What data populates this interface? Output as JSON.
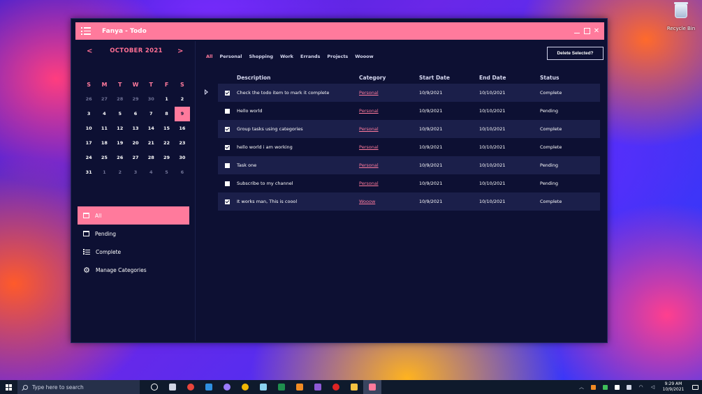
{
  "desktop": {
    "recycle_bin_label": "Recycle Bin"
  },
  "window": {
    "title": "Fanya - Todo",
    "close_glyph": "✕"
  },
  "calendar": {
    "prev": "<",
    "next": ">",
    "month_label": "OCTOBER 2021",
    "weekdays": [
      "S",
      "M",
      "T",
      "W",
      "T",
      "F",
      "S"
    ],
    "days": [
      {
        "n": "26",
        "other": true
      },
      {
        "n": "27",
        "other": true
      },
      {
        "n": "28",
        "other": true
      },
      {
        "n": "29",
        "other": true
      },
      {
        "n": "30",
        "other": true
      },
      {
        "n": "1"
      },
      {
        "n": "2"
      },
      {
        "n": "3"
      },
      {
        "n": "4"
      },
      {
        "n": "5"
      },
      {
        "n": "6"
      },
      {
        "n": "7"
      },
      {
        "n": "8"
      },
      {
        "n": "9",
        "today": true
      },
      {
        "n": "10"
      },
      {
        "n": "11"
      },
      {
        "n": "12"
      },
      {
        "n": "13"
      },
      {
        "n": "14"
      },
      {
        "n": "15"
      },
      {
        "n": "16"
      },
      {
        "n": "17"
      },
      {
        "n": "18"
      },
      {
        "n": "19"
      },
      {
        "n": "20"
      },
      {
        "n": "21"
      },
      {
        "n": "22"
      },
      {
        "n": "23"
      },
      {
        "n": "24"
      },
      {
        "n": "25"
      },
      {
        "n": "26"
      },
      {
        "n": "27"
      },
      {
        "n": "28"
      },
      {
        "n": "29"
      },
      {
        "n": "30"
      },
      {
        "n": "31"
      },
      {
        "n": "1",
        "other": true
      },
      {
        "n": "2",
        "other": true
      },
      {
        "n": "3",
        "other": true
      },
      {
        "n": "4",
        "other": true
      },
      {
        "n": "5",
        "other": true
      },
      {
        "n": "6",
        "other": true
      }
    ]
  },
  "nav": {
    "items": [
      {
        "label": "All",
        "icon": "calendar-icon",
        "active": true
      },
      {
        "label": "Pending",
        "icon": "calendar-icon"
      },
      {
        "label": "Complete",
        "icon": "list-icon"
      },
      {
        "label": "Manage Categories",
        "icon": "gear-icon"
      }
    ]
  },
  "filters": [
    "All",
    "Personal",
    "Shopping",
    "Work",
    "Errands",
    "Projects",
    "Wooow"
  ],
  "active_filter": "All",
  "delete_button": "Delete Selected?",
  "table": {
    "headers": {
      "description": "Description",
      "category": "Category",
      "start": "Start Date",
      "end": "End Date",
      "status": "Status"
    },
    "rows": [
      {
        "checked": true,
        "description": "Check the todo item to mark it complete",
        "category": "Personal",
        "start": "10/9/2021",
        "end": "10/10/2021",
        "status": "Complete"
      },
      {
        "checked": false,
        "description": "Hello world",
        "category": "Personal",
        "start": "10/9/2021",
        "end": "10/10/2021",
        "status": "Pending"
      },
      {
        "checked": true,
        "description": "Group tasks using categories",
        "category": "Personal",
        "start": "10/9/2021",
        "end": "10/10/2021",
        "status": "Complete"
      },
      {
        "checked": true,
        "description": "hello world i am working",
        "category": "Personal",
        "start": "10/9/2021",
        "end": "10/10/2021",
        "status": "Complete"
      },
      {
        "checked": false,
        "description": "Task one",
        "category": "Personal",
        "start": "10/9/2021",
        "end": "10/10/2021",
        "status": "Pending"
      },
      {
        "checked": false,
        "description": "Subscribe to my channel",
        "category": "Personal",
        "start": "10/9/2021",
        "end": "10/10/2021",
        "status": "Pending"
      },
      {
        "checked": true,
        "description": "It works man, This is coool",
        "category": "Wooow",
        "start": "10/9/2021",
        "end": "10/10/2021",
        "status": "Complete"
      }
    ]
  },
  "taskbar": {
    "search_placeholder": "Type here to search",
    "apps": [
      {
        "name": "cortana-icon",
        "color": "#ffffff"
      },
      {
        "name": "task-view-icon",
        "color": "#cfd4e4"
      },
      {
        "name": "chrome-icon",
        "color": "#e8453c"
      },
      {
        "name": "vscode-icon",
        "color": "#2f8fe0"
      },
      {
        "name": "github-icon",
        "color": "#9b7bff"
      },
      {
        "name": "chrome-canary-icon",
        "color": "#f2b705"
      },
      {
        "name": "notepad-icon",
        "color": "#8ad2f0"
      },
      {
        "name": "excel-icon",
        "color": "#1f8f4e"
      },
      {
        "name": "search-tool-icon",
        "color": "#f08a24"
      },
      {
        "name": "visual-studio-icon",
        "color": "#8e5ad6"
      },
      {
        "name": "record-icon",
        "color": "#e02424"
      },
      {
        "name": "file-explorer-icon",
        "color": "#f5c242"
      },
      {
        "name": "todo-app-icon",
        "color": "#ff7a9c",
        "active": true
      }
    ],
    "tray": [
      {
        "name": "chevron-up-icon",
        "glyph": "︿"
      },
      {
        "name": "tray-app-orange-icon",
        "color": "#f08a24"
      },
      {
        "name": "tray-app-green-icon",
        "color": "#3fbf5a"
      },
      {
        "name": "tray-app-grid-icon",
        "color": "#ffffff"
      },
      {
        "name": "security-icon",
        "color": "#cfd4e4"
      },
      {
        "name": "wifi-icon",
        "glyph": "◠"
      },
      {
        "name": "volume-icon",
        "glyph": "◁"
      }
    ],
    "time": "9:29 AM",
    "date": "10/9/2021"
  }
}
